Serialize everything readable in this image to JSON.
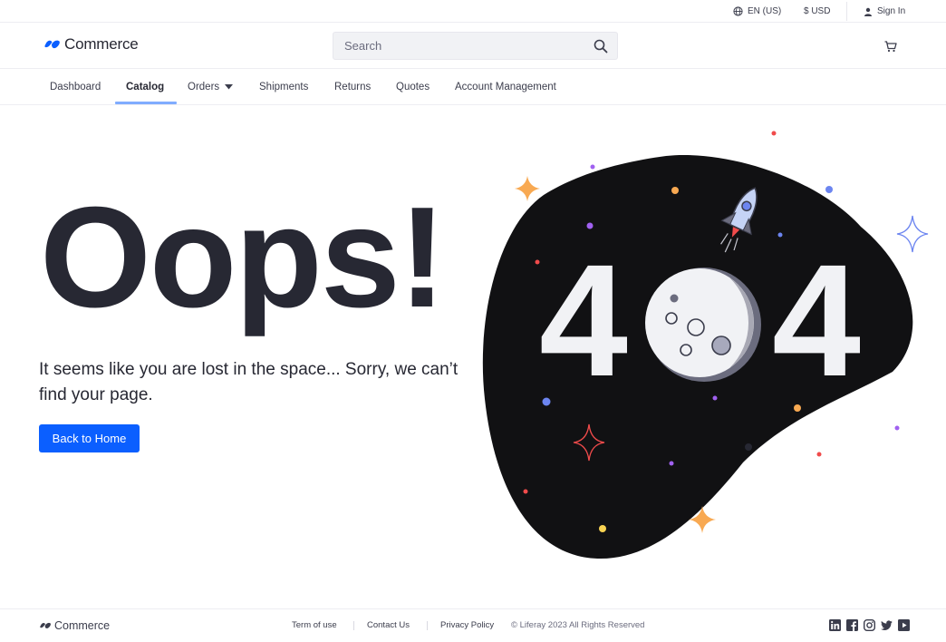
{
  "topbar": {
    "language": "EN (US)",
    "currency": "$ USD",
    "sign_in": "Sign In"
  },
  "header": {
    "brand": "Commerce",
    "search_placeholder": "Search"
  },
  "nav": {
    "items": [
      {
        "label": "Dashboard"
      },
      {
        "label": "Catalog",
        "active": true
      },
      {
        "label": "Orders",
        "has_dropdown": true
      },
      {
        "label": "Shipments"
      },
      {
        "label": "Returns"
      },
      {
        "label": "Quotes"
      },
      {
        "label": "Account Management"
      }
    ]
  },
  "main": {
    "headline": "Oops!",
    "message": "It seems like you are lost in the space... Sorry, we can’t find your page.",
    "button_label": "Back to Home",
    "error_code_left": "4",
    "error_code_right": "4"
  },
  "footer": {
    "brand": "Commerce",
    "links": [
      "Term of use",
      "Contact Us",
      "Privacy Policy"
    ],
    "copyright": "© Liferay 2023 All Rights Reserved",
    "social_icons": [
      "linkedin-icon",
      "facebook-icon",
      "instagram-icon",
      "twitter-icon",
      "youtube-icon"
    ]
  },
  "colors": {
    "primary": "#0b5fff",
    "text_dark": "#272833",
    "nav_underline": "#80acff",
    "blob": "#111113",
    "moon": "#f1f2f5",
    "moon_shadow": "#6b6c7e",
    "star_orange": "#f8a952",
    "star_red": "#f04b4b",
    "star_blue": "#6c85f0",
    "dot_purple": "#a061f0"
  }
}
